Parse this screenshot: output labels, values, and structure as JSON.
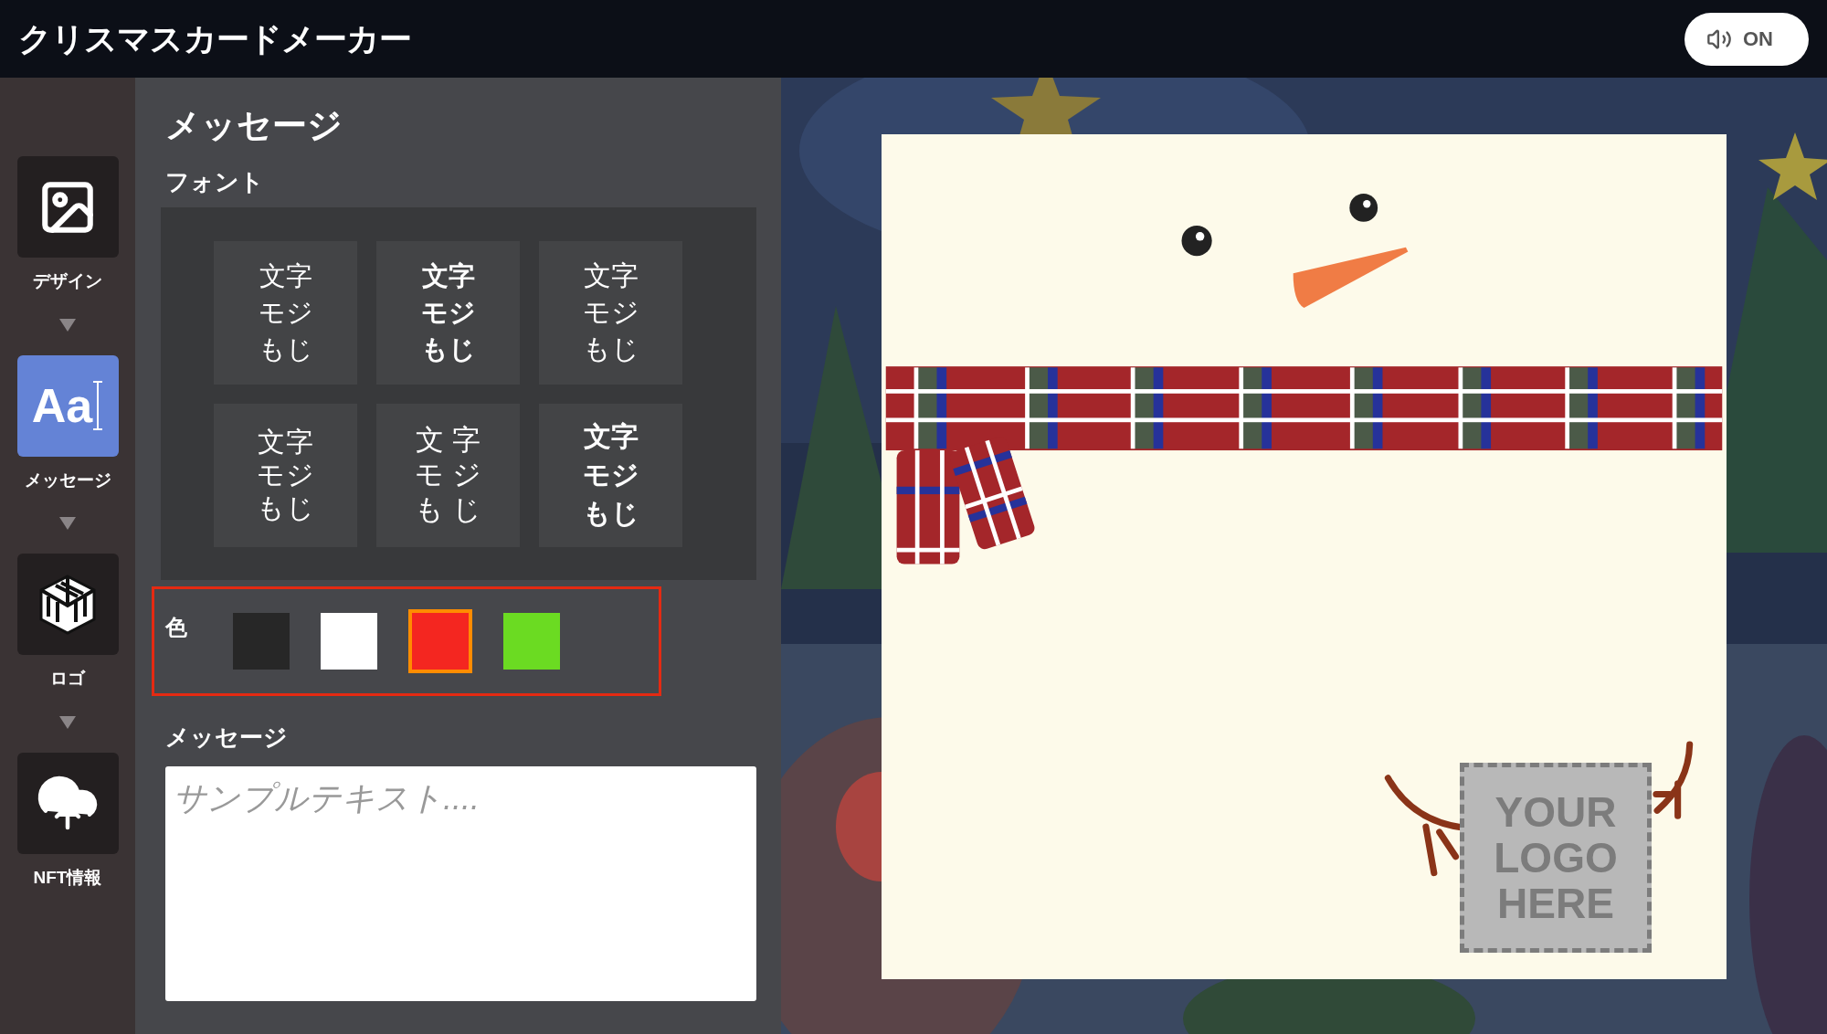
{
  "header": {
    "title": "クリスマスカードメーカー",
    "sound_button": {
      "label": "ON",
      "on": true
    }
  },
  "sidebar": {
    "items": [
      {
        "kind": "design",
        "label": "デザイン",
        "selected": false
      },
      {
        "kind": "message",
        "label": "メッセージ",
        "icon_text": "Aa",
        "selected": true
      },
      {
        "kind": "logo",
        "label": "ロゴ",
        "selected": false
      },
      {
        "kind": "nft",
        "label": "NFT情報",
        "selected": false
      }
    ]
  },
  "panel": {
    "title": "メッセージ",
    "font_label": "フォント",
    "fonts": [
      {
        "kind": "regular",
        "lines": [
          "文字",
          "モジ",
          "もじ"
        ]
      },
      {
        "kind": "medium",
        "lines": [
          "文字",
          "モジ",
          "もじ"
        ]
      },
      {
        "kind": "rounded",
        "lines": [
          "文字",
          "モジ",
          "もじ"
        ]
      },
      {
        "kind": "light",
        "lines": [
          "文字",
          "モジ",
          "もじ"
        ]
      },
      {
        "kind": "spaced",
        "lines": [
          "文 字",
          "モ ジ",
          "も じ"
        ]
      },
      {
        "kind": "heavy",
        "lines": [
          "文字",
          "モジ",
          "もじ"
        ]
      }
    ],
    "color_label": "色",
    "colors": [
      {
        "color": "#272727",
        "selected": false
      },
      {
        "color": "#ffffff",
        "selected": false
      },
      {
        "color": "#f42620",
        "selected": true
      },
      {
        "color": "#6bdb22",
        "selected": false
      }
    ],
    "message_label": "メッセージ",
    "message_placeholder": "サンプルテキスト...."
  },
  "card": {
    "logo_placeholder": [
      "YOUR",
      "LOGO",
      "HERE"
    ]
  }
}
